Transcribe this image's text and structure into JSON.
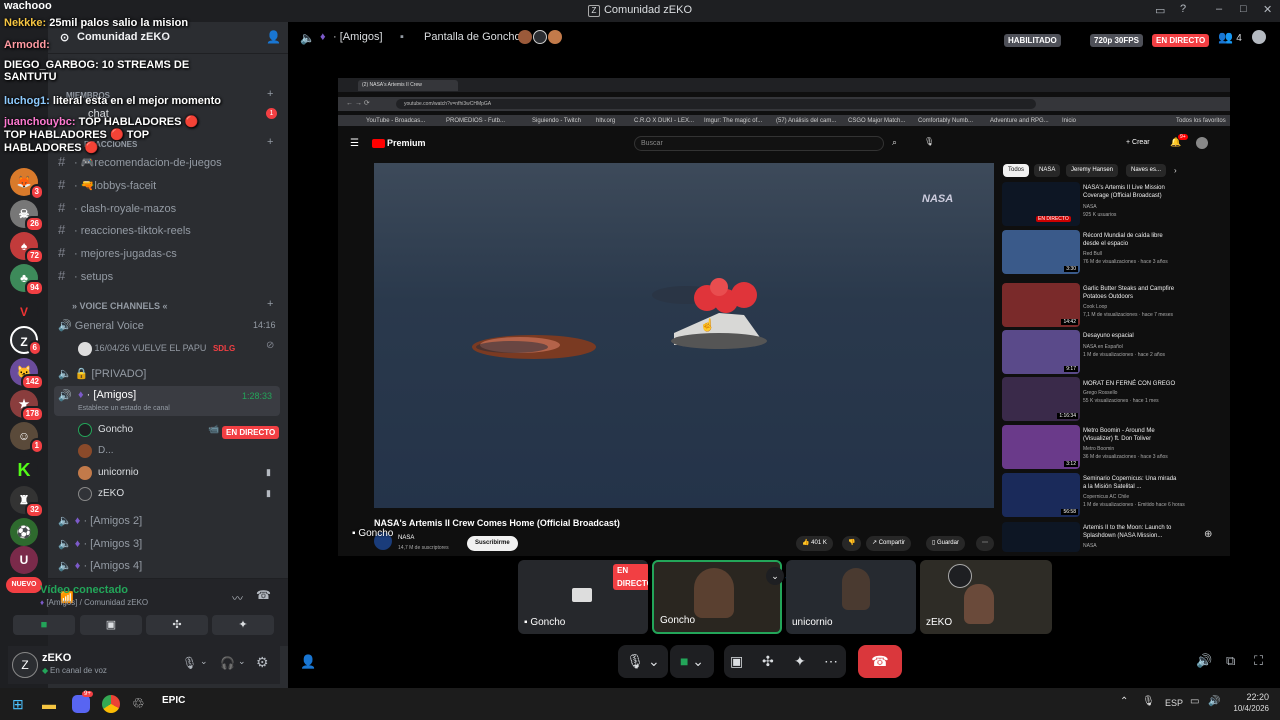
{
  "window": {
    "title": "Comunidad zEKO",
    "logo_label": "wachooo"
  },
  "colors": {
    "accent": "#23a559",
    "live": "#f23f43",
    "brand": "#5865f2"
  },
  "overlay_chat": [
    {
      "user": "Nekkke:",
      "text": "25mil palos salio la mision"
    },
    {
      "user": "Armodd:",
      "text": ""
    },
    {
      "user": "DIEGO_GARBOG:",
      "text": "10 STREAMS DE SANTUTU"
    },
    {
      "user": "luchog1:",
      "text": "literal esta en el mejor momento"
    },
    {
      "user": "juanchouybc:",
      "text": "TOP HABLADORES 🔴 TOP HABLADORES 🔴 TOP HABLADORES 🔴"
    }
  ],
  "servers": {
    "badges": [
      "3",
      "26",
      "72",
      "94",
      "6",
      "142",
      "178",
      "1",
      "32"
    ],
    "new_label": "NUEVO"
  },
  "sidebar": {
    "server_name": "Comunidad zEKO",
    "categories": {
      "members": "MIEMBROS",
      "reactions": "REACCIONES",
      "voice": "VOICE CHANNELS"
    },
    "chat_label": "chat",
    "chat_badge": "1",
    "text_channels": [
      "🎮recomendacion-de-juegos",
      "🔫lobbys-faceit",
      "clash-royale-mazos",
      "reacciones-tiktok-reels",
      "mejores-jugadas-cs",
      "setups"
    ],
    "voice_channels": {
      "general": "General Voice",
      "general_time": "14:16",
      "general_status": "16/04/26 VUELVE EL PAPU",
      "general_tag": "SDLG",
      "privado": "[PRIVADO]",
      "amigos": "[Amigos]",
      "amigos_time": "1:28:33",
      "amigos_status": "Establece un estado de canal",
      "amigos2": "[Amigos 2]",
      "amigos3": "[Amigos 3]",
      "amigos4": "[Amigos 4]"
    },
    "voice_users": [
      {
        "name": "Goncho",
        "badge": "EN DIRECTO"
      },
      {
        "name": "D..."
      },
      {
        "name": "unicornio"
      },
      {
        "name": "zEKO"
      }
    ]
  },
  "voice_panel": {
    "status": "Vídeo conectado",
    "location": "[Amigos] / Comunidad zEKO"
  },
  "user_panel": {
    "name": "zEKO",
    "status": "En canal de voz"
  },
  "header": {
    "channel": "[Amigos]",
    "screen": "Pantalla de Goncho",
    "enabled": "HABILITADO",
    "quality": "720p 30FPS",
    "live": "EN DIRECTO",
    "participants": "4"
  },
  "stream": {
    "streamer_label": "Goncho",
    "browser_tab": "(2) NASA's Artemis II Crew",
    "url": "youtube.com/watch?v=nfhi3wCHMpGA",
    "bookmarks": [
      "YouTube - Broadcas...",
      "PROMEDIOS - Futb...",
      "Siguiendo - Twitch",
      "hltv.org",
      "C.R.O X DUKI - LEX...",
      "Imgur: The magic of...",
      "(57) Análisis del cam...",
      "CSGO Major Match...",
      "Comfortably Numb...",
      "Adventure and RPG...",
      "Inicio"
    ],
    "bookmarks_all": "Todos los favoritos",
    "yt_logo": "Premium",
    "search_placeholder": "Buscar",
    "create_label": "Crear",
    "notif_count": "9+",
    "video_watermark": "NASA",
    "video_title": "NASA's Artemis II Crew Comes Home (Official Broadcast)",
    "channel_name": "NASA",
    "subscribers": "14,7 M de suscriptores",
    "subscribe": "Suscribirme",
    "likes": "401 K",
    "share": "Compartir",
    "save": "Guardar",
    "filters": [
      "Todos",
      "NASA",
      "Jeremy Hansen",
      "Naves es..."
    ],
    "related": [
      {
        "title": "NASA's Artemis II Live Mission Coverage (Official Broadcast)",
        "channel": "NASA",
        "meta": "925 K usuarios",
        "badge": "EN DIRECTO"
      },
      {
        "title": "Récord Mundial de caída libre desde el espacio",
        "channel": "Red Bull",
        "meta": "76 M de visualizaciones · hace 3 años",
        "duration": "3:30"
      },
      {
        "title": "Garlic Butter Steaks and Campfire Potatoes Outdoors",
        "channel": "Cook Loop",
        "meta": "7,1 M de visualizaciones · hace 7 meses",
        "duration": "14:42"
      },
      {
        "title": "Desayuno espacial",
        "channel": "NASA en Español",
        "meta": "1 M de visualizaciones · hace 2 años",
        "duration": "9:17"
      },
      {
        "title": "MORAT EN FERNÉ CON GREGO",
        "channel": "Grego Rossello",
        "meta": "55 K visualizaciones · hace 1 mes",
        "duration": "1:16:34"
      },
      {
        "title": "Metro Boomin - Around Me (Visualizer) ft. Don Toliver",
        "channel": "Metro Boomin",
        "meta": "36 M de visualizaciones · hace 3 años",
        "duration": "3:12"
      },
      {
        "title": "Seminario Copernicus: Una mirada a la Misión Satelital ...",
        "channel": "Copernicus AC Chile",
        "meta": "1 M de visualizaciones · Emitido hace 6 horas",
        "duration": "56:58"
      },
      {
        "title": "Artemis II to the Moon: Launch to Splashdown (NASA Mission...",
        "channel": "NASA",
        "meta": ""
      }
    ]
  },
  "tiles": [
    {
      "name": "Goncho",
      "live": "EN DIRECTO"
    },
    {
      "name": "Goncho"
    },
    {
      "name": "unicornio"
    },
    {
      "name": "zEKO"
    }
  ],
  "taskbar": {
    "lang": "ESP",
    "time": "22:20",
    "date": "10/4/2026",
    "discord_badge": "9+"
  }
}
